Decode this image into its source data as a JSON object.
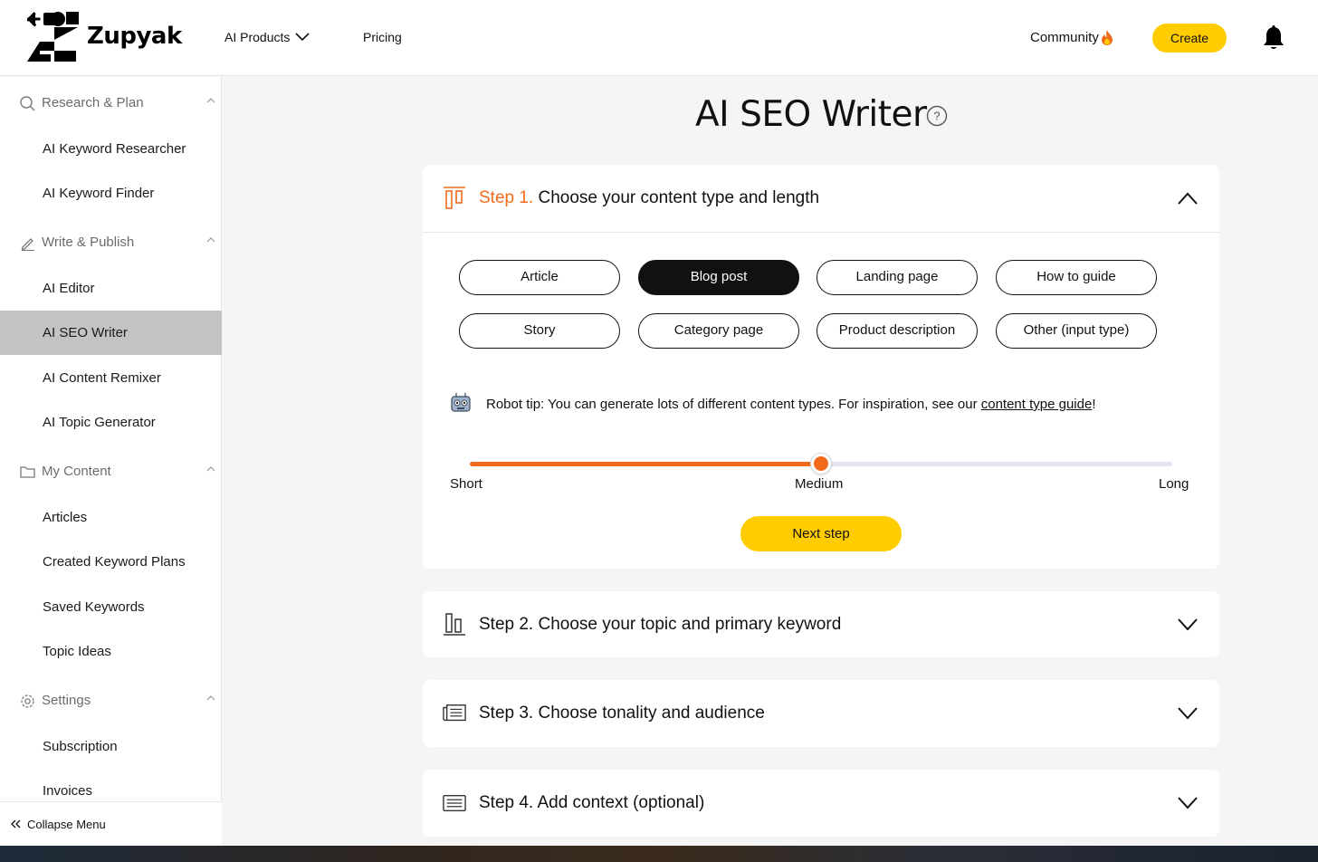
{
  "header": {
    "logo_text": "Zupyak",
    "nav_products": "AI Products",
    "nav_pricing": "Pricing",
    "community": "Community",
    "create_label": "Create"
  },
  "sidebar": {
    "sections": [
      {
        "label": "Research & Plan",
        "icon": "search-icon"
      },
      {
        "label": "Write & Publish",
        "icon": "pencil-icon"
      },
      {
        "label": "My Content",
        "icon": "folder-icon"
      },
      {
        "label": "Settings",
        "icon": "gear-icon"
      }
    ],
    "items": [
      {
        "label": "AI Keyword Researcher"
      },
      {
        "label": "AI Keyword Finder"
      },
      {
        "label": "AI Editor"
      },
      {
        "label": "AI SEO Writer"
      },
      {
        "label": "AI Content Remixer"
      },
      {
        "label": "AI Topic Generator"
      },
      {
        "label": "Articles"
      },
      {
        "label": "Created Keyword Plans"
      },
      {
        "label": "Saved Keywords"
      },
      {
        "label": "Topic Ideas"
      },
      {
        "label": "Subscription"
      },
      {
        "label": "Invoices"
      }
    ],
    "active_item": "AI SEO Writer",
    "collapse_label": "Collapse Menu"
  },
  "main": {
    "title": "AI SEO Writer",
    "steps": [
      {
        "num": "Step 1.",
        "title": "Choose your content type and length",
        "expanded": true
      },
      {
        "num": "Step 2.",
        "title": "Choose your topic and primary keyword",
        "expanded": false
      },
      {
        "num": "Step 3.",
        "title": "Choose tonality and audience",
        "expanded": false
      },
      {
        "num": "Step 4.",
        "title": "Add context (optional)",
        "expanded": false
      }
    ],
    "content_types": [
      "Article",
      "Blog post",
      "Landing page",
      "How to guide",
      "Story",
      "Category page",
      "Product description",
      "Other (input type)"
    ],
    "selected_type": "Blog post",
    "tip": {
      "prefix": "Robot tip: You can generate lots of different content types. For inspiration, see our ",
      "link": "content type guide",
      "suffix": "!"
    },
    "length": {
      "labels": [
        "Short",
        "Medium",
        "Long"
      ],
      "value": 0.5
    },
    "next_label": "Next step"
  },
  "colors": {
    "accent": "#f26a1b",
    "yellow": "#ffcc00",
    "active_bg": "#c3c3c3"
  }
}
